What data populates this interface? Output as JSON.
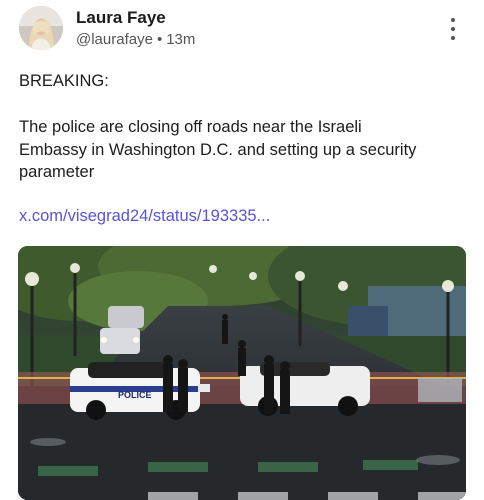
{
  "author": {
    "name": "Laura Faye",
    "handle": "@laurafaye",
    "separator": "•",
    "time": "13m"
  },
  "post": {
    "line1": "BREAKING:",
    "line2": "The police are closing off roads near the Israeli",
    "line3": "Embassy in Washington D.C. and setting up a security",
    "line4": "parameter",
    "link": "x.com/visegrad24/status/193335..."
  },
  "media": {
    "police_car_text": "POLICE"
  },
  "icons": {
    "more": "more-vertical-icon"
  }
}
